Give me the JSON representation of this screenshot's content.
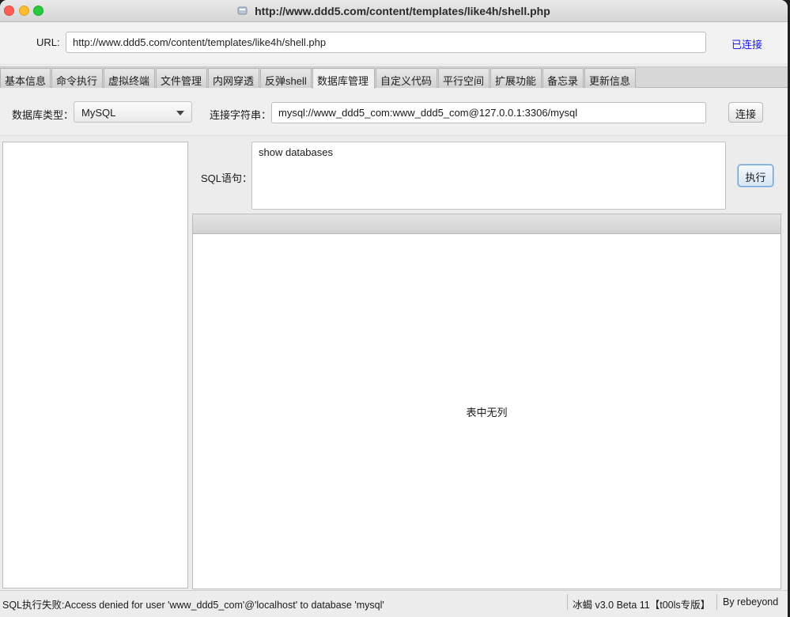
{
  "window": {
    "title": "http://www.ddd5.com/content/templates/like4h/shell.php"
  },
  "url_bar": {
    "label": "URL:",
    "value": "http://www.ddd5.com/content/templates/like4h/shell.php",
    "status": "已连接"
  },
  "tabs": [
    {
      "label": "基本信息"
    },
    {
      "label": "命令执行"
    },
    {
      "label": "虚拟终端"
    },
    {
      "label": "文件管理"
    },
    {
      "label": "内网穿透"
    },
    {
      "label": "反弹shell"
    },
    {
      "label": "数据库管理"
    },
    {
      "label": "自定义代码"
    },
    {
      "label": "平行空间"
    },
    {
      "label": "扩展功能"
    },
    {
      "label": "备忘录"
    },
    {
      "label": "更新信息"
    }
  ],
  "active_tab": "数据库管理",
  "connection": {
    "db_type_label": "数据库类型：",
    "db_type_value": "MySQL",
    "conn_string_label": "连接字符串：",
    "conn_string_value": "mysql://www_ddd5_com:www_ddd5_com@127.0.0.1:3306/mysql",
    "connect_button": "连接"
  },
  "sql": {
    "label": "SQL语句：",
    "value": "show databases",
    "execute_button": "执行"
  },
  "result": {
    "empty_text": "表中无列"
  },
  "statusbar": {
    "message": "SQL执行失败:Access denied for user 'www_ddd5_com'@'localhost' to database 'mysql'",
    "version": "冰蝎 v3.0 Beta 11【t00ls专版】",
    "author": "By rebeyond"
  },
  "colors": {
    "status_connected": "#1a1ae6",
    "close": "#fd5f57",
    "minimize": "#febc2e",
    "maximize": "#28c840"
  },
  "icons": [
    "close-icon",
    "minimize-icon",
    "maximize-icon",
    "app-icon",
    "dropdown-caret-icon"
  ]
}
